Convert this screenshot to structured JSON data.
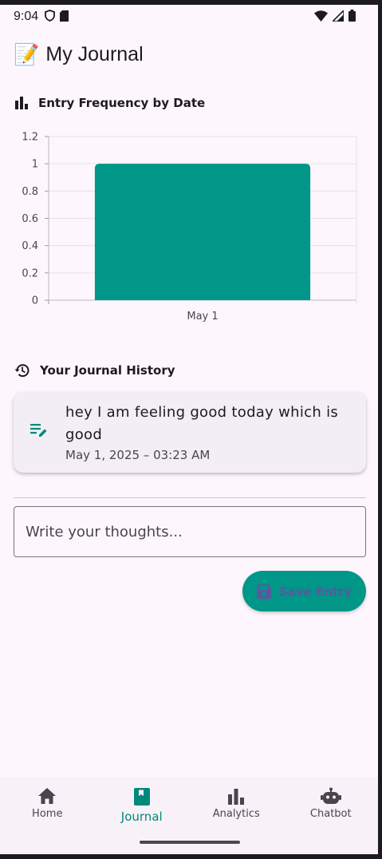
{
  "status": {
    "time": "9:04"
  },
  "header": {
    "emoji": "📝",
    "title": "My Journal"
  },
  "chart_section": {
    "title": "Entry Frequency by Date"
  },
  "chart_data": {
    "type": "bar",
    "categories": [
      "May 1"
    ],
    "values": [
      1
    ],
    "ylim": [
      0,
      1.2
    ],
    "yticks": [
      "0",
      "0.2",
      "0.4",
      "0.6",
      "0.8",
      "1",
      "1.2"
    ],
    "bar_color": "#009688",
    "grid": true
  },
  "history_section": {
    "title": "Your Journal History"
  },
  "entries": [
    {
      "text": "hey I am feeling good today which is good",
      "date": "May 1, 2025 – 03:23 AM"
    }
  ],
  "composer": {
    "placeholder": "Write your thoughts...",
    "save_label": "Save Entry"
  },
  "colors": {
    "accent": "#009688",
    "background": "#fdf7fd"
  },
  "nav": {
    "items": [
      {
        "label": "Home",
        "icon": "home-icon"
      },
      {
        "label": "Journal",
        "icon": "journal-icon"
      },
      {
        "label": "Analytics",
        "icon": "analytics-icon"
      },
      {
        "label": "Chatbot",
        "icon": "chatbot-icon"
      }
    ],
    "active": "Journal"
  }
}
